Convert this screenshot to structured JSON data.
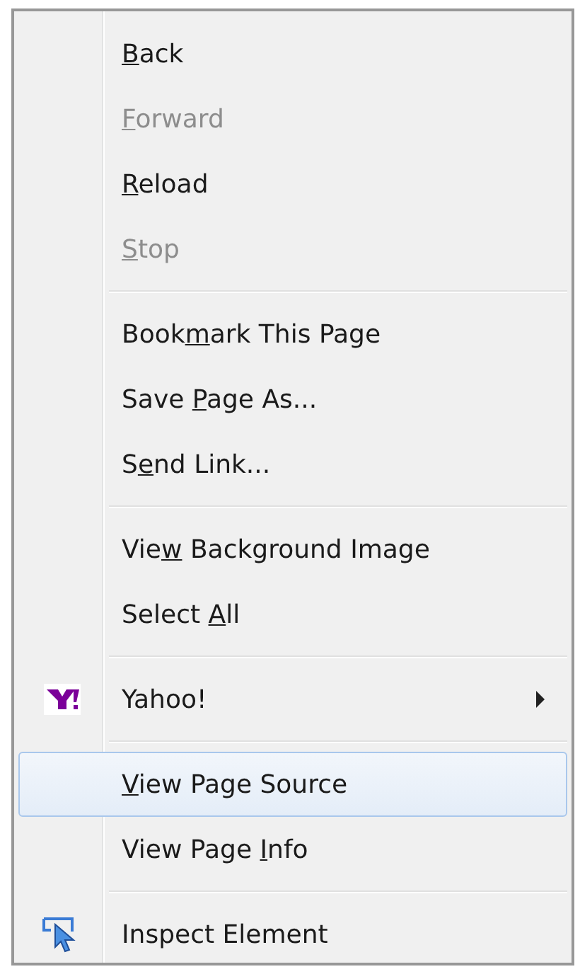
{
  "menu": {
    "groups": [
      {
        "items": [
          {
            "kind": "plain",
            "label": [
              {
                "text": "B",
                "underlined": true
              },
              {
                "text": "ack",
                "underlined": false
              }
            ],
            "disabled": false,
            "selected": false
          },
          {
            "kind": "plain",
            "label": [
              {
                "text": "F",
                "underlined": true
              },
              {
                "text": "orward",
                "underlined": false
              }
            ],
            "disabled": true,
            "selected": false
          },
          {
            "kind": "plain",
            "label": [
              {
                "text": "R",
                "underlined": true
              },
              {
                "text": "eload",
                "underlined": false
              }
            ],
            "disabled": false,
            "selected": false
          },
          {
            "kind": "plain",
            "label": [
              {
                "text": "S",
                "underlined": true
              },
              {
                "text": "top",
                "underlined": false
              }
            ],
            "disabled": true,
            "selected": false
          }
        ]
      },
      {
        "items": [
          {
            "kind": "plain",
            "label": [
              {
                "text": "Book",
                "underlined": false
              },
              {
                "text": "m",
                "underlined": true
              },
              {
                "text": "ark This Page",
                "underlined": false
              }
            ],
            "disabled": false,
            "selected": false
          },
          {
            "kind": "plain",
            "label": [
              {
                "text": "Save ",
                "underlined": false
              },
              {
                "text": "P",
                "underlined": true
              },
              {
                "text": "age As...",
                "underlined": false
              }
            ],
            "disabled": false,
            "selected": false
          },
          {
            "kind": "plain",
            "label": [
              {
                "text": "S",
                "underlined": false
              },
              {
                "text": "e",
                "underlined": true
              },
              {
                "text": "nd Link...",
                "underlined": false
              }
            ],
            "disabled": false,
            "selected": false
          }
        ]
      },
      {
        "items": [
          {
            "kind": "plain",
            "label": [
              {
                "text": "Vie",
                "underlined": false
              },
              {
                "text": "w",
                "underlined": true
              },
              {
                "text": " Background Image",
                "underlined": false
              }
            ],
            "disabled": false,
            "selected": false
          },
          {
            "kind": "plain",
            "label": [
              {
                "text": "Select ",
                "underlined": false
              },
              {
                "text": "A",
                "underlined": true
              },
              {
                "text": "ll",
                "underlined": false
              }
            ],
            "disabled": false,
            "selected": false
          }
        ]
      },
      {
        "items": [
          {
            "kind": "logo",
            "label": [
              {
                "text": "Yahoo!",
                "underlined": false
              }
            ],
            "submenu": true,
            "disabled": false,
            "selected": false
          }
        ]
      },
      {
        "items": [
          {
            "kind": "plain",
            "label": [
              {
                "text": "V",
                "underlined": true
              },
              {
                "text": "iew Page Source",
                "underlined": false
              }
            ],
            "disabled": false,
            "selected": true
          },
          {
            "kind": "plain",
            "label": [
              {
                "text": "View Page ",
                "underlined": false
              },
              {
                "text": "I",
                "underlined": true
              },
              {
                "text": "nfo",
                "underlined": false
              }
            ],
            "disabled": false,
            "selected": false
          }
        ]
      },
      {
        "items": [
          {
            "kind": "inspect",
            "label": [
              {
                "text": "Inspect Element",
                "underlined": false
              }
            ],
            "disabled": false,
            "selected": false
          }
        ]
      }
    ]
  }
}
